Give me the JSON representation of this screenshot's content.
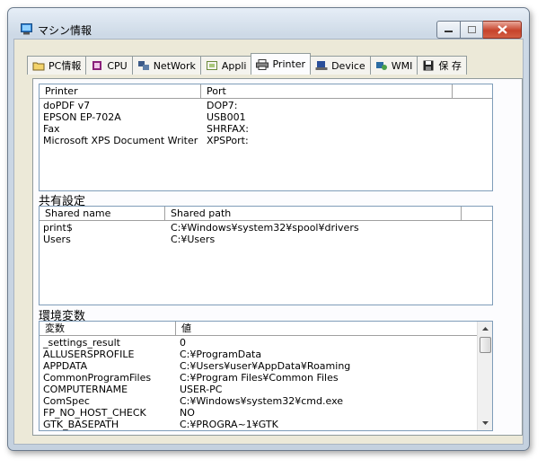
{
  "window": {
    "title": "マシン情報"
  },
  "tabs": [
    {
      "label": "PC情報",
      "icon": "folder-icon"
    },
    {
      "label": "CPU",
      "icon": "chip-icon"
    },
    {
      "label": "NetWork",
      "icon": "network-icon"
    },
    {
      "label": "Appli",
      "icon": "appli-icon"
    },
    {
      "label": "Printer",
      "icon": "printer-icon",
      "active": true
    },
    {
      "label": "Device",
      "icon": "device-icon"
    },
    {
      "label": "WMI",
      "icon": "wmi-icon"
    },
    {
      "label": "保 存",
      "icon": "save-icon"
    }
  ],
  "printers": {
    "headers": [
      "Printer",
      "Port"
    ],
    "rows": [
      [
        "doPDF v7",
        "DOP7:"
      ],
      [
        "EPSON EP-702A",
        "USB001"
      ],
      [
        "Fax",
        "SHRFAX:"
      ],
      [
        "Microsoft XPS Document Writer",
        "XPSPort:"
      ]
    ]
  },
  "shares": {
    "label": "共有設定",
    "headers": [
      "Shared name",
      "Shared path"
    ],
    "rows": [
      [
        "print$",
        "C:¥Windows¥system32¥spool¥drivers"
      ],
      [
        "Users",
        "C:¥Users"
      ]
    ]
  },
  "env": {
    "label": "環境変数",
    "headers": [
      "変数",
      "値"
    ],
    "rows": [
      [
        "_settings_result",
        "0"
      ],
      [
        "ALLUSERSPROFILE",
        "C:¥ProgramData"
      ],
      [
        "APPDATA",
        "C:¥Users¥user¥AppData¥Roaming"
      ],
      [
        "CommonProgramFiles",
        "C:¥Program Files¥Common Files"
      ],
      [
        "COMPUTERNAME",
        "USER-PC"
      ],
      [
        "ComSpec",
        "C:¥Windows¥system32¥cmd.exe"
      ],
      [
        "FP_NO_HOST_CHECK",
        "NO"
      ],
      [
        "GTK_BASEPATH",
        "C:¥PROGRA~1¥GTK"
      ]
    ]
  },
  "colors": {
    "accent": "#c7432b",
    "panel": "#ece9d8",
    "list_border": "#7f9db9"
  }
}
